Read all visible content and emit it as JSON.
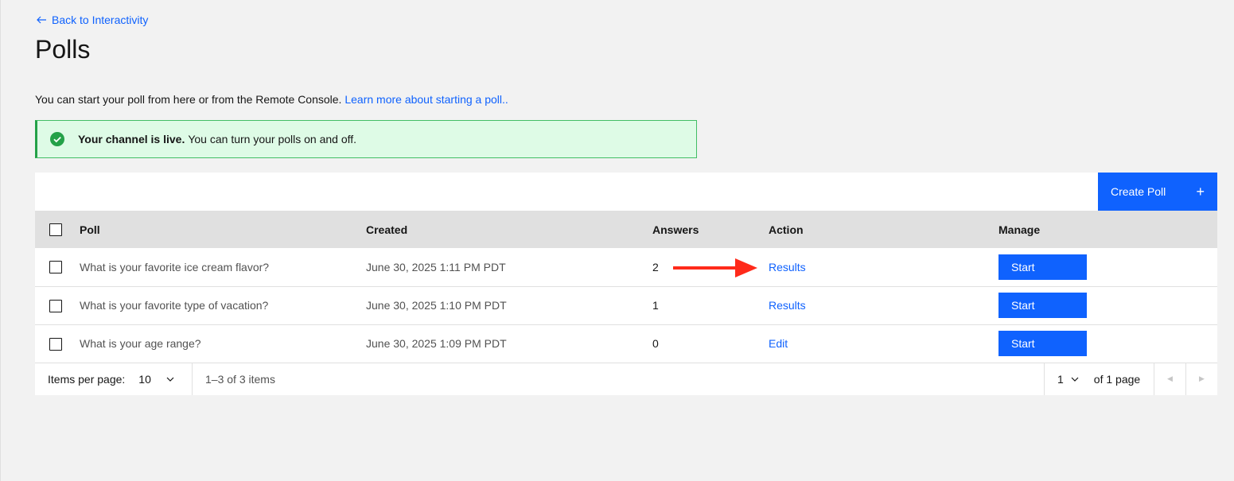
{
  "nav": {
    "back_label": "Back to Interactivity"
  },
  "page": {
    "title": "Polls"
  },
  "intro": {
    "text": "You can start your poll from here or from the Remote Console.",
    "link": "Learn more about starting a poll.."
  },
  "notification": {
    "title": "Your channel is live.",
    "message": "You can turn your polls on and off."
  },
  "toolbar": {
    "create_label": "Create Poll",
    "create_icon": "+"
  },
  "table": {
    "headers": [
      "Poll",
      "Created",
      "Answers",
      "Action",
      "Manage"
    ],
    "rows": [
      {
        "poll": "What is your favorite ice cream flavor?",
        "created": "June 30, 2025 1:11 PM PDT",
        "answers": "2",
        "action": "Results",
        "manage": "Start"
      },
      {
        "poll": "What is your favorite type of vacation?",
        "created": "June 30, 2025 1:10 PM PDT",
        "answers": "1",
        "action": "Results",
        "manage": "Start"
      },
      {
        "poll": "What is your age range?",
        "created": "June 30, 2025 1:09 PM PDT",
        "answers": "0",
        "action": "Edit",
        "manage": "Start"
      }
    ]
  },
  "pagination": {
    "items_per_page_label": "Items per page:",
    "items_per_page_value": "10",
    "range": "1–3 of 3 items",
    "page_value": "1",
    "of_pages": "of 1 page"
  },
  "colors": {
    "primary": "#0f62fe",
    "success_bg": "#defbe6",
    "success_border": "#24a148",
    "annotation_arrow": "#ff2a1a"
  }
}
